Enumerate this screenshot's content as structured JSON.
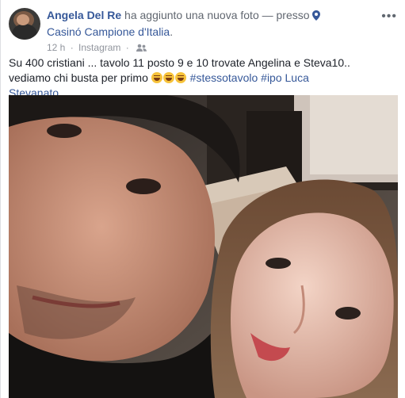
{
  "post": {
    "author": "Angela Del Re",
    "action": "ha aggiunto una nuova foto",
    "separator": "—",
    "location_prefix": "presso",
    "location": "Casinó Campione d'Italia",
    "location_end": ".",
    "time": "12 h",
    "dot": "·",
    "source": "Instagram",
    "privacy_icon": "friends-icon",
    "more_label": "•••",
    "text_main": "Su 400 cristiani ... tavolo 11 posto 9 e 10 trovate Angelina e Steva10.. vediamo chi busta per primo ",
    "emoji_count": 3,
    "emoji_name": "laughing-tears-emoji",
    "hashtags": [
      "#stessotavolo",
      "#ipo"
    ],
    "mention": "Luca Stevanato",
    "photo_name": "selfie-photo"
  },
  "colors": {
    "link": "#365899",
    "meta": "#90949c",
    "text": "#1d2129"
  }
}
